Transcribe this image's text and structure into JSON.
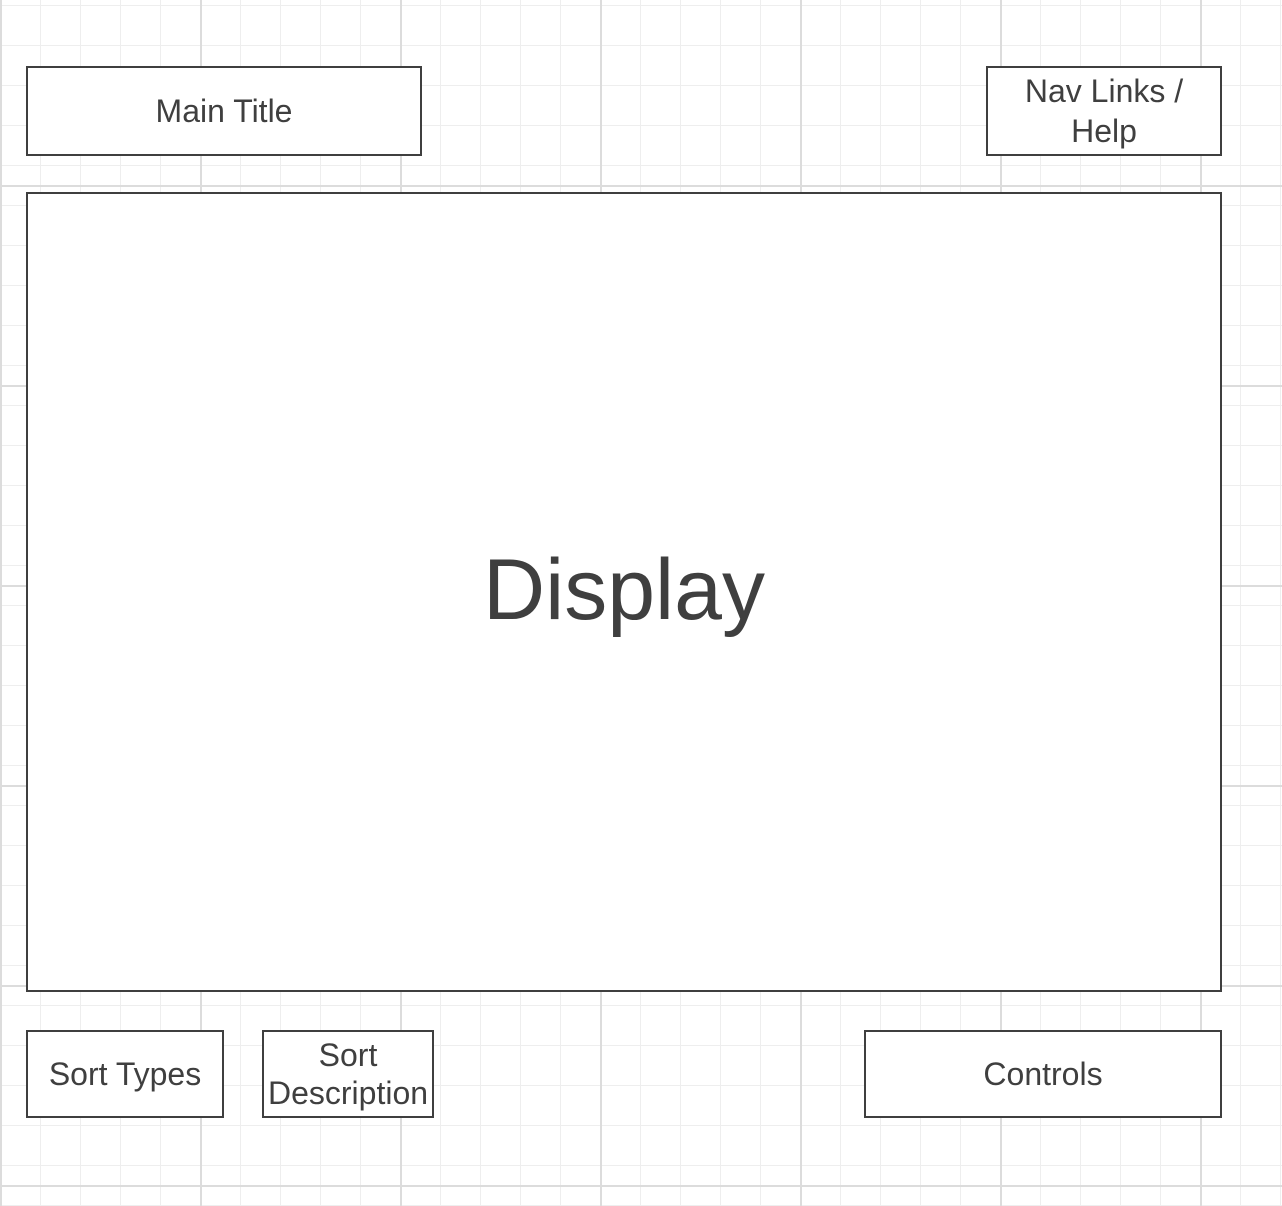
{
  "boxes": {
    "main_title": "Main Title",
    "nav_links_line1": "Nav Links /",
    "nav_links_line2": "Help",
    "display": "Display",
    "sort_types": "Sort Types",
    "sort_description_line1": "Sort",
    "sort_description_line2": "Description",
    "controls": "Controls"
  },
  "colors": {
    "stroke": "#3f3f3f",
    "grid_major": "#dcdcdc",
    "grid_minor": "#eeeeee",
    "fill": "#ffffff"
  }
}
